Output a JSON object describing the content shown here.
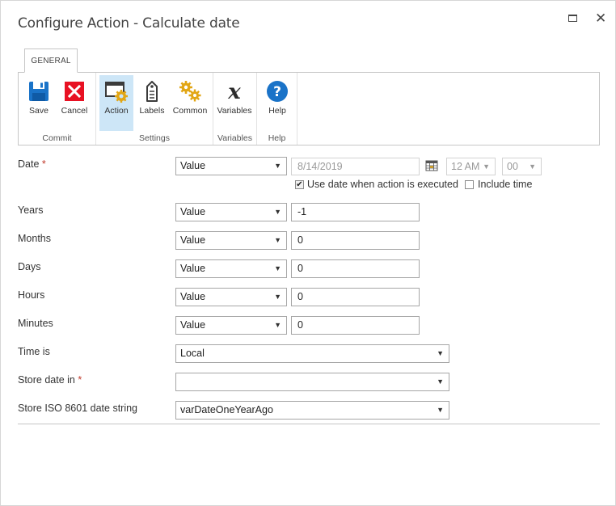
{
  "window": {
    "title": "Configure Action - Calculate date",
    "maximize_icon": "maximize-icon",
    "close_icon": "close-icon",
    "close_glyph": "✕"
  },
  "ribbon": {
    "tab_label": "GENERAL",
    "groups": [
      {
        "label": "Commit",
        "buttons": [
          {
            "label": "Save",
            "icon": "save-icon"
          },
          {
            "label": "Cancel",
            "icon": "cancel-icon"
          }
        ]
      },
      {
        "label": "Settings",
        "buttons": [
          {
            "label": "Action",
            "icon": "action-icon",
            "selected": true
          },
          {
            "label": "Labels",
            "icon": "labels-icon"
          },
          {
            "label": "Common",
            "icon": "common-gears-icon"
          }
        ]
      },
      {
        "label": "Variables",
        "buttons": [
          {
            "label": "Variables",
            "icon": "variables-x-icon"
          }
        ]
      },
      {
        "label": "Help",
        "buttons": [
          {
            "label": "Help",
            "icon": "help-icon"
          }
        ]
      }
    ]
  },
  "form": {
    "date": {
      "label": "Date",
      "required_mark": "*",
      "type": "Value",
      "value": "8/14/2019",
      "hour": "12 AM",
      "minute": "00",
      "use_date_checkbox": {
        "label": "Use date when action is executed",
        "checked": true
      },
      "include_time_checkbox": {
        "label": "Include time",
        "checked": false
      }
    },
    "years": {
      "label": "Years",
      "type": "Value",
      "value": "-1"
    },
    "months": {
      "label": "Months",
      "type": "Value",
      "value": "0"
    },
    "days": {
      "label": "Days",
      "type": "Value",
      "value": "0"
    },
    "hours": {
      "label": "Hours",
      "type": "Value",
      "value": "0"
    },
    "minutes": {
      "label": "Minutes",
      "type": "Value",
      "value": "0"
    },
    "time_is": {
      "label": "Time is",
      "value": "Local"
    },
    "store_date_in": {
      "label": "Store date in",
      "required_mark": "*",
      "value": ""
    },
    "store_iso": {
      "label": "Store ISO 8601 date string",
      "value": "varDateOneYearAgo"
    }
  },
  "colors": {
    "accent_blue": "#1a73c8",
    "cancel_red": "#e81123",
    "gear_yellow": "#e2a614",
    "selected_bg": "#cde6f7",
    "required_red": "#c0392b"
  }
}
